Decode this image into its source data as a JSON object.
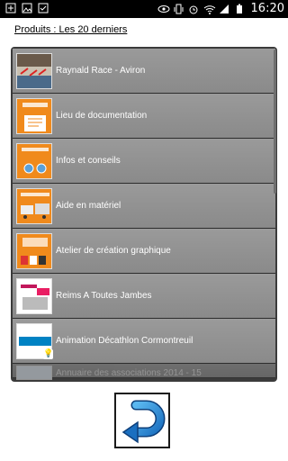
{
  "status": {
    "time": "16:20",
    "left_icons": [
      "add-icon",
      "image-icon",
      "check-icon"
    ],
    "right_icons": [
      "eye-icon",
      "vibrate-icon",
      "alarm-icon",
      "wifi-icon",
      "signal-icon",
      "battery-icon"
    ]
  },
  "header": {
    "title": "Produits : Les 20 derniers"
  },
  "products": [
    {
      "label": "Raynald Race - Aviron",
      "thumb": "rowing-photo"
    },
    {
      "label": "Lieu de documentation",
      "thumb": "documentation-graphic"
    },
    {
      "label": "Infos et conseils",
      "thumb": "info-graphic"
    },
    {
      "label": "Aide en matériel",
      "thumb": "equipment-graphic"
    },
    {
      "label": "Atelier de création graphique",
      "thumb": "graphic-workshop"
    },
    {
      "label": "Reims A Toutes Jambes",
      "thumb": "reims-poster"
    },
    {
      "label": "Animation Décathlon Cormontreuil",
      "thumb": "decathlon-logo"
    },
    {
      "label": "Annuaire des associations 2014 - 15",
      "thumb": "directory-cover"
    }
  ],
  "colors": {
    "row_bg": "#8f8f8f",
    "list_bg": "#3b3b3b",
    "orange": "#f08a1c",
    "decathlon_blue": "#0082c3"
  }
}
